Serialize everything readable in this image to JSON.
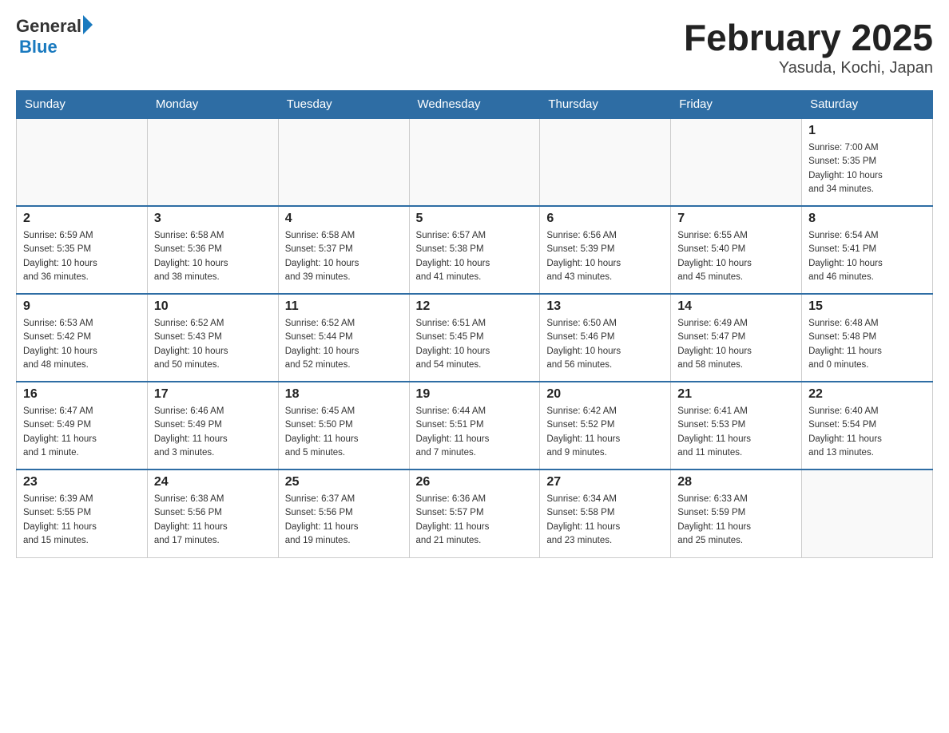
{
  "header": {
    "logo": {
      "general": "General",
      "arrow": "▶",
      "blue": "Blue"
    },
    "title": "February 2025",
    "subtitle": "Yasuda, Kochi, Japan"
  },
  "weekdays": [
    "Sunday",
    "Monday",
    "Tuesday",
    "Wednesday",
    "Thursday",
    "Friday",
    "Saturday"
  ],
  "weeks": [
    [
      {
        "day": "",
        "info": ""
      },
      {
        "day": "",
        "info": ""
      },
      {
        "day": "",
        "info": ""
      },
      {
        "day": "",
        "info": ""
      },
      {
        "day": "",
        "info": ""
      },
      {
        "day": "",
        "info": ""
      },
      {
        "day": "1",
        "info": "Sunrise: 7:00 AM\nSunset: 5:35 PM\nDaylight: 10 hours\nand 34 minutes."
      }
    ],
    [
      {
        "day": "2",
        "info": "Sunrise: 6:59 AM\nSunset: 5:35 PM\nDaylight: 10 hours\nand 36 minutes."
      },
      {
        "day": "3",
        "info": "Sunrise: 6:58 AM\nSunset: 5:36 PM\nDaylight: 10 hours\nand 38 minutes."
      },
      {
        "day": "4",
        "info": "Sunrise: 6:58 AM\nSunset: 5:37 PM\nDaylight: 10 hours\nand 39 minutes."
      },
      {
        "day": "5",
        "info": "Sunrise: 6:57 AM\nSunset: 5:38 PM\nDaylight: 10 hours\nand 41 minutes."
      },
      {
        "day": "6",
        "info": "Sunrise: 6:56 AM\nSunset: 5:39 PM\nDaylight: 10 hours\nand 43 minutes."
      },
      {
        "day": "7",
        "info": "Sunrise: 6:55 AM\nSunset: 5:40 PM\nDaylight: 10 hours\nand 45 minutes."
      },
      {
        "day": "8",
        "info": "Sunrise: 6:54 AM\nSunset: 5:41 PM\nDaylight: 10 hours\nand 46 minutes."
      }
    ],
    [
      {
        "day": "9",
        "info": "Sunrise: 6:53 AM\nSunset: 5:42 PM\nDaylight: 10 hours\nand 48 minutes."
      },
      {
        "day": "10",
        "info": "Sunrise: 6:52 AM\nSunset: 5:43 PM\nDaylight: 10 hours\nand 50 minutes."
      },
      {
        "day": "11",
        "info": "Sunrise: 6:52 AM\nSunset: 5:44 PM\nDaylight: 10 hours\nand 52 minutes."
      },
      {
        "day": "12",
        "info": "Sunrise: 6:51 AM\nSunset: 5:45 PM\nDaylight: 10 hours\nand 54 minutes."
      },
      {
        "day": "13",
        "info": "Sunrise: 6:50 AM\nSunset: 5:46 PM\nDaylight: 10 hours\nand 56 minutes."
      },
      {
        "day": "14",
        "info": "Sunrise: 6:49 AM\nSunset: 5:47 PM\nDaylight: 10 hours\nand 58 minutes."
      },
      {
        "day": "15",
        "info": "Sunrise: 6:48 AM\nSunset: 5:48 PM\nDaylight: 11 hours\nand 0 minutes."
      }
    ],
    [
      {
        "day": "16",
        "info": "Sunrise: 6:47 AM\nSunset: 5:49 PM\nDaylight: 11 hours\nand 1 minute."
      },
      {
        "day": "17",
        "info": "Sunrise: 6:46 AM\nSunset: 5:49 PM\nDaylight: 11 hours\nand 3 minutes."
      },
      {
        "day": "18",
        "info": "Sunrise: 6:45 AM\nSunset: 5:50 PM\nDaylight: 11 hours\nand 5 minutes."
      },
      {
        "day": "19",
        "info": "Sunrise: 6:44 AM\nSunset: 5:51 PM\nDaylight: 11 hours\nand 7 minutes."
      },
      {
        "day": "20",
        "info": "Sunrise: 6:42 AM\nSunset: 5:52 PM\nDaylight: 11 hours\nand 9 minutes."
      },
      {
        "day": "21",
        "info": "Sunrise: 6:41 AM\nSunset: 5:53 PM\nDaylight: 11 hours\nand 11 minutes."
      },
      {
        "day": "22",
        "info": "Sunrise: 6:40 AM\nSunset: 5:54 PM\nDaylight: 11 hours\nand 13 minutes."
      }
    ],
    [
      {
        "day": "23",
        "info": "Sunrise: 6:39 AM\nSunset: 5:55 PM\nDaylight: 11 hours\nand 15 minutes."
      },
      {
        "day": "24",
        "info": "Sunrise: 6:38 AM\nSunset: 5:56 PM\nDaylight: 11 hours\nand 17 minutes."
      },
      {
        "day": "25",
        "info": "Sunrise: 6:37 AM\nSunset: 5:56 PM\nDaylight: 11 hours\nand 19 minutes."
      },
      {
        "day": "26",
        "info": "Sunrise: 6:36 AM\nSunset: 5:57 PM\nDaylight: 11 hours\nand 21 minutes."
      },
      {
        "day": "27",
        "info": "Sunrise: 6:34 AM\nSunset: 5:58 PM\nDaylight: 11 hours\nand 23 minutes."
      },
      {
        "day": "28",
        "info": "Sunrise: 6:33 AM\nSunset: 5:59 PM\nDaylight: 11 hours\nand 25 minutes."
      },
      {
        "day": "",
        "info": ""
      }
    ]
  ]
}
